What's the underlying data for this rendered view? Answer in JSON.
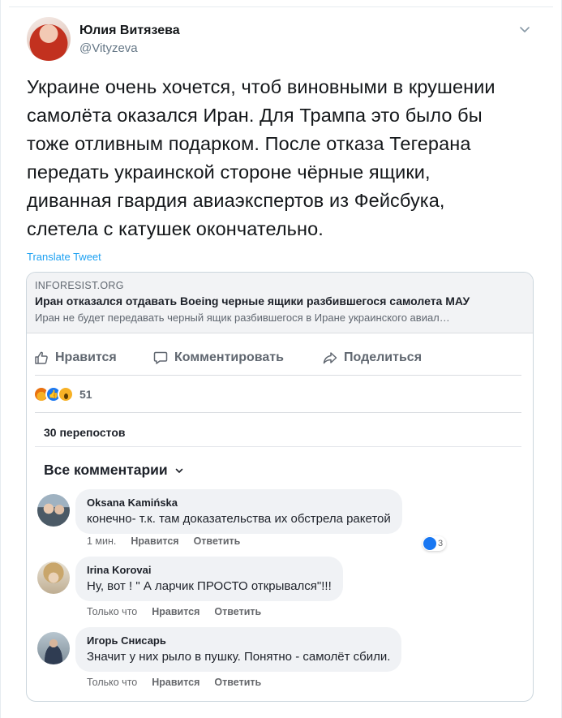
{
  "tweet": {
    "author_name": "Юлия Витязева",
    "author_handle": "@Vityzeva",
    "text_lines": [
      "Украине очень хочется, чтоб виновными в крушении",
      "самолёта оказался Иран. Для Трампа это было бы",
      "тоже отливным подарком. После отказа Тегерана",
      "передать украинской стороне чёрные ящики,",
      "диванная гвардия авиаэкспертов из Фейсбука,",
      "слетела с катушек окончательно."
    ],
    "translate_label": "Translate Tweet"
  },
  "embed": {
    "link": {
      "domain": "INFORESIST.ORG",
      "title": "Иран отказался отдавать Boeing черные ящики разбившегося самолета МАУ",
      "description": "Иран не будет передавать черный ящик разбившегося в Иране украинского авиал…"
    },
    "actions": {
      "like": "Нравится",
      "comment": "Комментировать",
      "share": "Поделиться"
    },
    "reaction_count": "51",
    "shares": "30 перепостов",
    "all_comments": "Все комментарии",
    "comments": [
      {
        "name": "Oksana Kamińska",
        "text": "конечно- т.к. там доказательства их обстрела ракетой",
        "time": "1 мин.",
        "like": "Нравится",
        "reply": "Ответить",
        "reaction_count": "3"
      },
      {
        "name": "Irina Korovai",
        "text": "Ну, вот ! \" А ларчик ПРОСТО открывался\"!!!",
        "time": "Только что",
        "like": "Нравится",
        "reply": "Ответить"
      },
      {
        "name": "Игорь Снисарь",
        "text": "Значит у них рыло в пушку. Понятно - самолёт сбили.",
        "time": "Только что",
        "like": "Нравится",
        "reply": "Ответить"
      }
    ]
  },
  "colors": {
    "twitter_blue": "#1da1f2",
    "fb_blue": "#1877f2",
    "fb_grey_text": "#606770",
    "bubble_bg": "#f0f2f5"
  }
}
